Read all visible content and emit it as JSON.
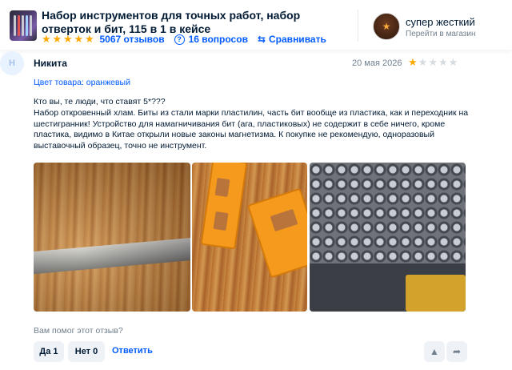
{
  "product": {
    "title": "Набор инструментов для точных работ, набор отверток и бит, 115 в 1 в кейсе",
    "reviews_count": "5067 отзывов",
    "questions": "16 вопросов",
    "compare": "Сравнивать",
    "rating_stars": 5
  },
  "shop": {
    "name": "супер жесткий",
    "link": "Перейти в магазин"
  },
  "review": {
    "avatar_letter": "Н",
    "author": "Никита",
    "date": "20 мая 2026",
    "rating": 1,
    "rating_max": 5,
    "color": "Цвет товара: оранжевый",
    "text": "Кто вы, те люди, что ставят 5*???\nНабор откровенный хлам. Биты из стали марки пластилин, часть бит вообще из пластика, как и переходник на шестигранник! Устройство для намагничивания бит (ага, пластиковых) не содержит в себе ничего, кроме пластика, видимо в Китае открыли новые законы магнетизма. К покупке не рекомендую, одноразовый выставочный образец, точно не инструмент."
  },
  "feedback": {
    "question": "Вам помог этот отзыв?",
    "yes": "Да 1",
    "no": "Нет 0",
    "reply": "Ответить"
  },
  "colors": {
    "accent": "#005bff",
    "star": "#ffa800",
    "muted": "#707f8d"
  }
}
